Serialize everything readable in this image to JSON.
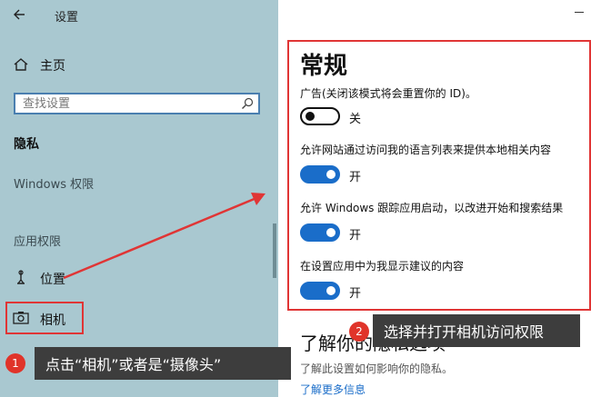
{
  "window": {
    "title": "设置",
    "back_icon": "back-arrow-icon",
    "minimize_icon": "minimize-icon"
  },
  "sidebar": {
    "home_label": "主页",
    "home_icon": "home-icon",
    "search": {
      "placeholder": "查找设置",
      "icon": "search-icon"
    },
    "privacy_heading": "隐私",
    "windows_permissions": "Windows 权限",
    "app_permissions": "应用权限",
    "items": [
      {
        "label": "位置",
        "icon": "location-icon"
      },
      {
        "label": "相机",
        "icon": "camera-icon",
        "highlighted": true
      }
    ]
  },
  "main": {
    "heading": "常规",
    "settings": [
      {
        "label": "广告(关闭该模式将会重置你的 ID)。",
        "state": "关",
        "on": false
      },
      {
        "label": "允许网站通过访问我的语言列表来提供本地相关内容",
        "state": "开",
        "on": true
      },
      {
        "label": "允许 Windows 跟踪应用启动，以改进开始和搜索结果",
        "state": "开",
        "on": true
      },
      {
        "label": "在设置应用中为我显示建议的内容",
        "state": "开",
        "on": true
      }
    ],
    "learn_more": {
      "title": "了解你的隐私选项",
      "description": "了解此设置如何影响你的隐私。",
      "link": "了解更多信息"
    }
  },
  "annotations": {
    "callout_1": {
      "number": "1",
      "text": "点击“相机”或者是“摄像头”"
    },
    "callout_2": {
      "number": "2",
      "text": "选择并打开相机访问权限"
    },
    "highlight_color": "#e03535",
    "accent_color": "#1a6dc9"
  }
}
